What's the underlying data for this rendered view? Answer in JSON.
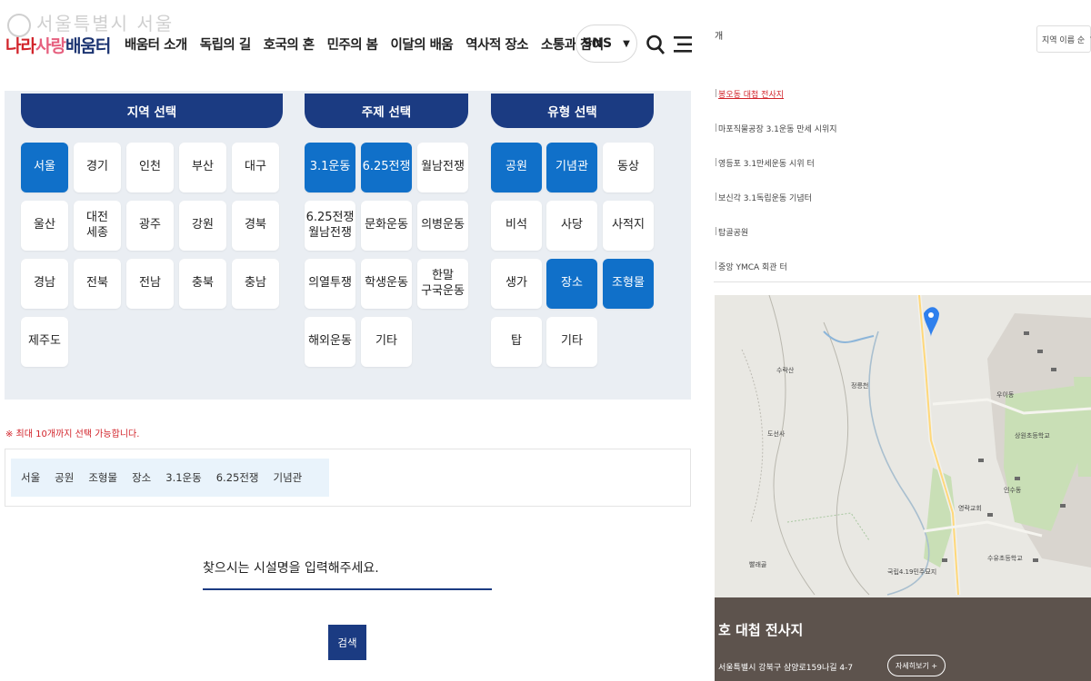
{
  "header": {
    "watermark": "서울특별시 서울",
    "logo": {
      "part1": "나라",
      "part2": "사랑",
      "part3": "배움터"
    },
    "nav": [
      "배움터 소개",
      "독립의 길",
      "호국의 혼",
      "민주의 봄",
      "이달의 배움",
      "역사적 장소",
      "소통과 참여"
    ],
    "sns_label": "SNS"
  },
  "filters": {
    "region": {
      "title": "지역 선택",
      "items": [
        {
          "label": "서울",
          "selected": true
        },
        {
          "label": "경기",
          "selected": false
        },
        {
          "label": "인천",
          "selected": false
        },
        {
          "label": "부산",
          "selected": false
        },
        {
          "label": "대구",
          "selected": false
        },
        {
          "label": "울산",
          "selected": false
        },
        {
          "label": "대전\n세종",
          "selected": false
        },
        {
          "label": "광주",
          "selected": false
        },
        {
          "label": "강원",
          "selected": false
        },
        {
          "label": "경북",
          "selected": false
        },
        {
          "label": "경남",
          "selected": false
        },
        {
          "label": "전북",
          "selected": false
        },
        {
          "label": "전남",
          "selected": false
        },
        {
          "label": "충북",
          "selected": false
        },
        {
          "label": "충남",
          "selected": false
        },
        {
          "label": "제주도",
          "selected": false
        }
      ]
    },
    "theme": {
      "title": "주제 선택",
      "items": [
        {
          "label": "3.1운동",
          "selected": true
        },
        {
          "label": "6.25전쟁",
          "selected": true
        },
        {
          "label": "월남전쟁",
          "selected": false
        },
        {
          "label": "6.25전쟁\n월남전쟁",
          "selected": false
        },
        {
          "label": "문화운동",
          "selected": false
        },
        {
          "label": "의병운동",
          "selected": false
        },
        {
          "label": "의열투쟁",
          "selected": false
        },
        {
          "label": "학생운동",
          "selected": false
        },
        {
          "label": "한말\n구국운동",
          "selected": false
        },
        {
          "label": "해외운동",
          "selected": false
        },
        {
          "label": "기타",
          "selected": false
        }
      ]
    },
    "type": {
      "title": "유형 선택",
      "items": [
        {
          "label": "공원",
          "selected": true
        },
        {
          "label": "기념관",
          "selected": true
        },
        {
          "label": "동상",
          "selected": false
        },
        {
          "label": "비석",
          "selected": false
        },
        {
          "label": "사당",
          "selected": false
        },
        {
          "label": "사적지",
          "selected": false
        },
        {
          "label": "생가",
          "selected": false
        },
        {
          "label": "장소",
          "selected": true
        },
        {
          "label": "조형물",
          "selected": true
        },
        {
          "label": "탑",
          "selected": false
        },
        {
          "label": "기타",
          "selected": false
        }
      ]
    }
  },
  "notice": "※ 최대 10개까지 선택 가능합니다.",
  "selected_tags": [
    "서울",
    "공원",
    "조형물",
    "장소",
    "3.1운동",
    "6.25전쟁",
    "기념관"
  ],
  "search": {
    "placeholder": "찾으시는 시설명을 입력해주세요.",
    "button_label": "검색"
  },
  "right_panel": {
    "top_fragment": "개",
    "sort_label": "지역 이름 순",
    "places": [
      {
        "name": "봉오동 대첩 전사지",
        "active": true
      },
      {
        "name": "마포직물공장 3.1운동 만세 시위지",
        "active": false
      },
      {
        "name": "영등포 3.1만세운동 시위 터",
        "active": false
      },
      {
        "name": "보신각 3.1독립운동 기념터",
        "active": false
      },
      {
        "name": "탑골공원",
        "active": false
      },
      {
        "name": "중앙 YMCA 회관 터",
        "active": false
      }
    ],
    "map_labels": [
      "수락산",
      "도선사",
      "정릉천",
      "우이동",
      "상원초등학교",
      "인수동",
      "수유초등학교",
      "영락교회",
      "국립4.19민주묘지",
      "빨래골"
    ],
    "detail": {
      "title": "호 대첩 전사지",
      "address": "서울특별시 강북구 삼양로159나길 4-7",
      "more_label": "자세히보기 +"
    }
  },
  "colors": {
    "navy": "#1b3b82",
    "selected_blue": "#1070c9",
    "notice_red": "#d2232a",
    "filter_bg": "#eaeef3"
  }
}
